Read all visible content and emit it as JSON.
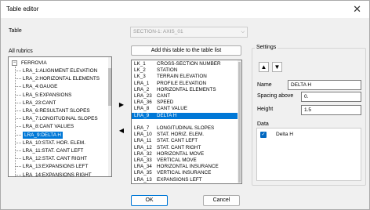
{
  "window": {
    "title": "Table editor",
    "close_glyph": "✕"
  },
  "table_label": "Table",
  "table_combo_value": "SECTION-1: AXIS_01",
  "add_button_label": "Add this table to the table list",
  "all_rubrics_label": "All rubrics",
  "tree": {
    "root": "FERROVIA",
    "items": [
      "LRA_1:ALIGNMENT ELEVATION",
      "LRA_2:HORIZONTAL ELEMENTS",
      "LRA_4:GAUGE",
      "LRA_5:EXPANSIONS",
      "LRA_23:CANT",
      "LRA_6:RESULTANT SLOPES",
      "LRA_7:LONGITUDINAL SLOPES",
      "LRA_8:CANT VALUES",
      "LRA_9:DELTA H",
      "LRA_10:STAT. HOR. ELEM.",
      "LRA_11:STAT. CANT LEFT",
      "LRA_12:STAT. CANT RIGHT",
      "LRA_13:EXPANSIONS LEFT",
      "LRA_14:EXPANSIONS RIGHT"
    ],
    "selected_index": 8
  },
  "table_rows": [
    {
      "code": "LK_1",
      "name": "CROSS-SECTION NUMBER"
    },
    {
      "code": "LK_2",
      "name": "STATION"
    },
    {
      "code": "LK_3",
      "name": "TERRAIN ELEVATION"
    },
    {
      "code": "LRA_1",
      "name": "PROFILE ELEVATION"
    },
    {
      "code": "LRA_2",
      "name": "HORIZONTAL ELEMENTS"
    },
    {
      "code": "LRA_23",
      "name": "CANT"
    },
    {
      "code": "LRA_36",
      "name": "SPEED"
    },
    {
      "code": "LRA_8",
      "name": "CANT VALUE"
    },
    {
      "code": "LRA_9",
      "name": "DELTA H"
    },
    {
      "code": "",
      "name": ""
    },
    {
      "code": "LRA_7",
      "name": "LONGITUDINAL SLOPES"
    },
    {
      "code": "LRA_10",
      "name": "STAT. HORIZ. ELEM."
    },
    {
      "code": "LRA_11",
      "name": "STAT. CANT LEFT"
    },
    {
      "code": "LRA_12",
      "name": "STAT. CANT RIGHT"
    },
    {
      "code": "LRA_32",
      "name": "HORIZONTAL MOVE"
    },
    {
      "code": "LRA_33",
      "name": "VERTICAL MOVE"
    },
    {
      "code": "LRA_34",
      "name": "HORIZONTAL INSURANCE"
    },
    {
      "code": "LRA_35",
      "name": "VERTICAL INSURANCE"
    },
    {
      "code": "LRA_13",
      "name": "EXPANSIONS LEFT"
    }
  ],
  "table_selected_index": 8,
  "move_right_glyph": "▶",
  "move_left_glyph": "◀",
  "settings": {
    "title": "Settings",
    "move_up_glyph": "▲",
    "move_down_glyph": "▼",
    "name_label": "Name",
    "name_value": "DELTA H",
    "spacing_label": "Spacing above",
    "spacing_value": "0.",
    "height_label": "Height",
    "height_value": "1.5",
    "data_label": "Data",
    "data_item_label": "Delta H",
    "data_item_checked": true,
    "check_glyph": "✓"
  },
  "ok_label": "OK",
  "cancel_label": "Cancel",
  "accent_color": "#0078d7"
}
